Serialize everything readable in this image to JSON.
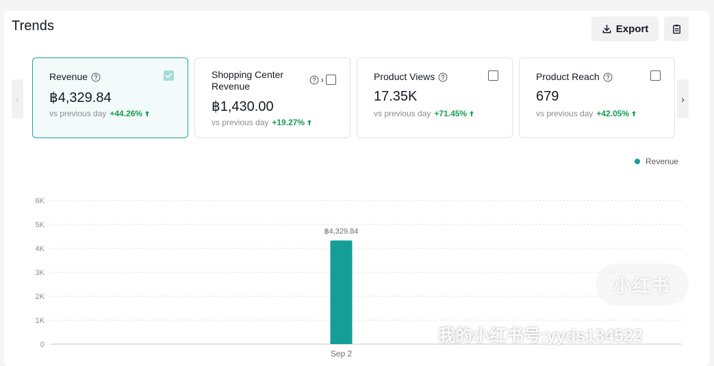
{
  "header": {
    "title": "Trends",
    "export_label": "Export"
  },
  "cards": [
    {
      "label": "Revenue",
      "value": "฿4,329.84",
      "sub": "vs previous day",
      "change": "+44.26%",
      "checked": true
    },
    {
      "label": "Shopping Center Revenue",
      "value": "฿1,430.00",
      "sub": "vs previous day",
      "change": "+19.27%",
      "checked": false
    },
    {
      "label": "Product Views",
      "value": "17.35K",
      "sub": "vs previous day",
      "change": "+71.45%",
      "checked": false
    },
    {
      "label": "Product Reach",
      "value": "679",
      "sub": "vs previous day",
      "change": "+42.05%",
      "checked": false
    }
  ],
  "legend": {
    "label": "Revenue",
    "color": "#149e97"
  },
  "chart_data": {
    "type": "bar",
    "categories": [
      "Sep 2"
    ],
    "series": [
      {
        "name": "Revenue",
        "values": [
          4329.84
        ]
      }
    ],
    "data_labels": [
      "฿4,329.84"
    ],
    "ylim": [
      0,
      6000
    ],
    "yticks": [
      0,
      1000,
      2000,
      3000,
      4000,
      5000,
      6000
    ],
    "ytick_labels": [
      "0",
      "1K",
      "2K",
      "3K",
      "4K",
      "5K",
      "6K"
    ],
    "grid": true,
    "legend_position": "top-right",
    "bar_color": "#149e97"
  },
  "watermark": {
    "badge": "小红书",
    "text": "我的小红书号:yyds134522"
  },
  "icons": {
    "export": "download-icon",
    "clipboard": "clipboard-icon",
    "help": "question-circle-icon",
    "trend": "arrow-up-icon",
    "prev": "chevron-left-icon",
    "next": "chevron-right-icon"
  }
}
